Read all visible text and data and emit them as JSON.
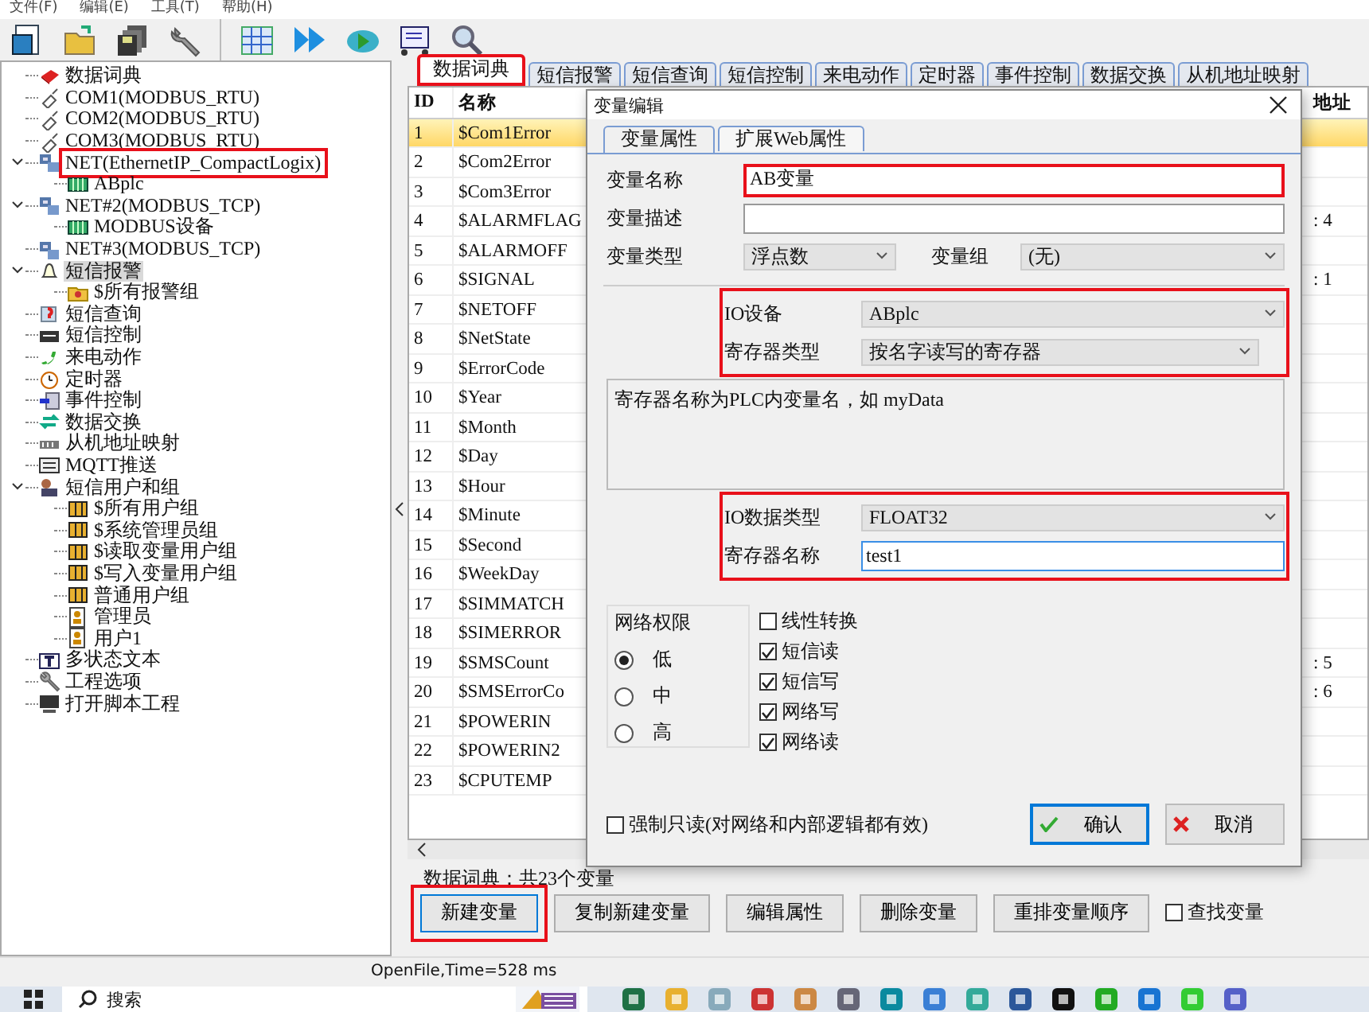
{
  "menu": [
    "文件(F)",
    "编辑(E)",
    "工具(T)",
    "帮助(H)"
  ],
  "tree": [
    {
      "label": "数据词典",
      "kind": "book"
    },
    {
      "label": "COM1(MODBUS_RTU)",
      "kind": "plug"
    },
    {
      "label": "COM2(MODBUS_RTU)",
      "kind": "plug"
    },
    {
      "label": "COM3(MODBUS_RTU)",
      "kind": "plug"
    },
    {
      "label": "NET(EthernetIP_CompactLogix)",
      "kind": "network",
      "expanded": true,
      "highlighted": true,
      "children": [
        {
          "label": "ABplc",
          "kind": "device"
        }
      ]
    },
    {
      "label": "NET#2(MODBUS_TCP)",
      "kind": "network",
      "expanded": true,
      "children": [
        {
          "label": "MODBUS设备",
          "kind": "device"
        }
      ]
    },
    {
      "label": "NET#3(MODBUS_TCP)",
      "kind": "network"
    },
    {
      "label": "短信报警",
      "kind": "bell",
      "expanded": true,
      "selected": true,
      "children": [
        {
          "label": "$所有报警组",
          "kind": "folder"
        }
      ]
    },
    {
      "label": "短信查询",
      "kind": "query"
    },
    {
      "label": "短信控制",
      "kind": "sms"
    },
    {
      "label": "来电动作",
      "kind": "phone"
    },
    {
      "label": "定时器",
      "kind": "timer"
    },
    {
      "label": "事件控制",
      "kind": "event"
    },
    {
      "label": "数据交换",
      "kind": "exchange"
    },
    {
      "label": "从机地址映射",
      "kind": "map"
    },
    {
      "label": "MQTT推送",
      "kind": "mqtt"
    },
    {
      "label": "短信用户和组",
      "kind": "users",
      "expanded": true,
      "children": [
        {
          "label": "$所有用户组",
          "kind": "group"
        },
        {
          "label": "$系统管理员组",
          "kind": "group"
        },
        {
          "label": "$读取变量用户组",
          "kind": "group"
        },
        {
          "label": "$写入变量用户组",
          "kind": "group"
        },
        {
          "label": "普通用户组",
          "kind": "group"
        },
        {
          "label": "管理员",
          "kind": "user"
        },
        {
          "label": "用户1",
          "kind": "user"
        }
      ]
    },
    {
      "label": "多状态文本",
      "kind": "text"
    },
    {
      "label": "工程选项",
      "kind": "wrench"
    },
    {
      "label": "打开脚本工程",
      "kind": "script"
    }
  ],
  "tabs": [
    {
      "label": "数据词典",
      "selected": true,
      "highlighted": true
    },
    {
      "label": "短信报警",
      "selected": false
    },
    {
      "label": "短信查询",
      "selected": false
    },
    {
      "label": "短信控制",
      "selected": false
    },
    {
      "label": "来电动作",
      "selected": false
    },
    {
      "label": "定时器",
      "selected": false
    },
    {
      "label": "事件控制",
      "selected": false
    },
    {
      "label": "数据交换",
      "selected": false
    },
    {
      "label": "从机地址映射",
      "selected": false
    }
  ],
  "table": {
    "columns": [
      "ID",
      "名称",
      "地址"
    ],
    "rows": [
      {
        "id": "1",
        "name": "$Com1Error",
        "selected": true
      },
      {
        "id": "2",
        "name": "$Com2Error",
        "selected": false
      },
      {
        "id": "3",
        "name": "$Com3Error",
        "selected": false
      },
      {
        "id": "4",
        "name": "$ALARMFLAG",
        "selected": false,
        "column_3": ": 4"
      },
      {
        "id": "5",
        "name": "$ALARMOFF",
        "selected": false
      },
      {
        "id": "6",
        "name": "$SIGNAL",
        "selected": false,
        "column_3": ": 1"
      },
      {
        "id": "7",
        "name": "$NETOFF",
        "selected": false
      },
      {
        "id": "8",
        "name": "$NetState",
        "selected": false
      },
      {
        "id": "9",
        "name": "$ErrorCode",
        "selected": false
      },
      {
        "id": "10",
        "name": "$Year",
        "selected": false
      },
      {
        "id": "11",
        "name": "$Month",
        "selected": false
      },
      {
        "id": "12",
        "name": "$Day",
        "selected": false
      },
      {
        "id": "13",
        "name": "$Hour",
        "selected": false
      },
      {
        "id": "14",
        "name": "$Minute",
        "selected": false
      },
      {
        "id": "15",
        "name": "$Second",
        "selected": false
      },
      {
        "id": "16",
        "name": "$WeekDay",
        "selected": false
      },
      {
        "id": "17",
        "name": "$SIMMATCH",
        "selected": false
      },
      {
        "id": "18",
        "name": "$SIMERROR",
        "selected": false
      },
      {
        "id": "19",
        "name": "$SMSCount",
        "selected": false,
        "column_3": ": 5"
      },
      {
        "id": "20",
        "name": "$SMSErrorCo",
        "selected": false,
        "column_3": ": 6"
      },
      {
        "id": "21",
        "name": "$POWERIN",
        "selected": false
      },
      {
        "id": "22",
        "name": "$POWERIN2",
        "selected": false
      },
      {
        "id": "23",
        "name": "$CPUTEMP",
        "selected": false
      }
    ]
  },
  "summary": "数据词典：共23个变量",
  "buttons": [
    {
      "label": "新建变量",
      "highlighted": true
    },
    {
      "label": "复制新建变量",
      "highlighted": false
    },
    {
      "label": "编辑属性",
      "highlighted": false
    },
    {
      "label": "删除变量",
      "highlighted": false
    },
    {
      "label": "重排变量顺序",
      "highlighted": false
    }
  ],
  "find_checkbox": {
    "label": "查找变量",
    "checked": false
  },
  "status_bar": "OpenFile,Time=528 ms",
  "dialog": {
    "title": "变量编辑",
    "tabs": [
      {
        "label": "变量属性",
        "selected": true
      },
      {
        "label": "扩展Web属性",
        "selected": false
      }
    ],
    "name": {
      "label": "变量名称",
      "value": "AB变量",
      "highlighted": true
    },
    "description": {
      "label": "变量描述"
    },
    "type": {
      "label": "变量类型",
      "value": "浮点数"
    },
    "group": {
      "label": "变量组",
      "value": "(无)"
    },
    "io_device": {
      "label": "IO设备",
      "value": "ABplc"
    },
    "register_type": {
      "label": "寄存器类型",
      "value": "按名字读写的寄存器"
    },
    "io_highlighted": true,
    "note": "寄存器名称为PLC内变量名，如 myData",
    "io_data_type": {
      "label": "IO数据类型",
      "value": "FLOAT32"
    },
    "register_name": {
      "label": "寄存器名称",
      "value": "test1",
      "focused": true
    },
    "data_highlighted": true,
    "permission": {
      "title": "网络权限",
      "options": [
        {
          "label": "低",
          "selected": true
        },
        {
          "label": "中",
          "selected": false
        },
        {
          "label": "高",
          "selected": false
        }
      ]
    },
    "options": [
      {
        "label": "线性转换",
        "checked": false
      },
      {
        "label": "短信读",
        "checked": true
      },
      {
        "label": "短信写",
        "checked": true
      },
      {
        "label": "网络写",
        "checked": true
      },
      {
        "label": "网络读",
        "checked": true
      }
    ],
    "readonly": {
      "label": "强制只读(对网络和内部逻辑都有效)",
      "checked": false
    },
    "ok": {
      "label": "确认",
      "default": true
    },
    "cancel": {
      "label": "取消"
    }
  },
  "taskbar": {
    "search_placeholder": "搜索"
  }
}
